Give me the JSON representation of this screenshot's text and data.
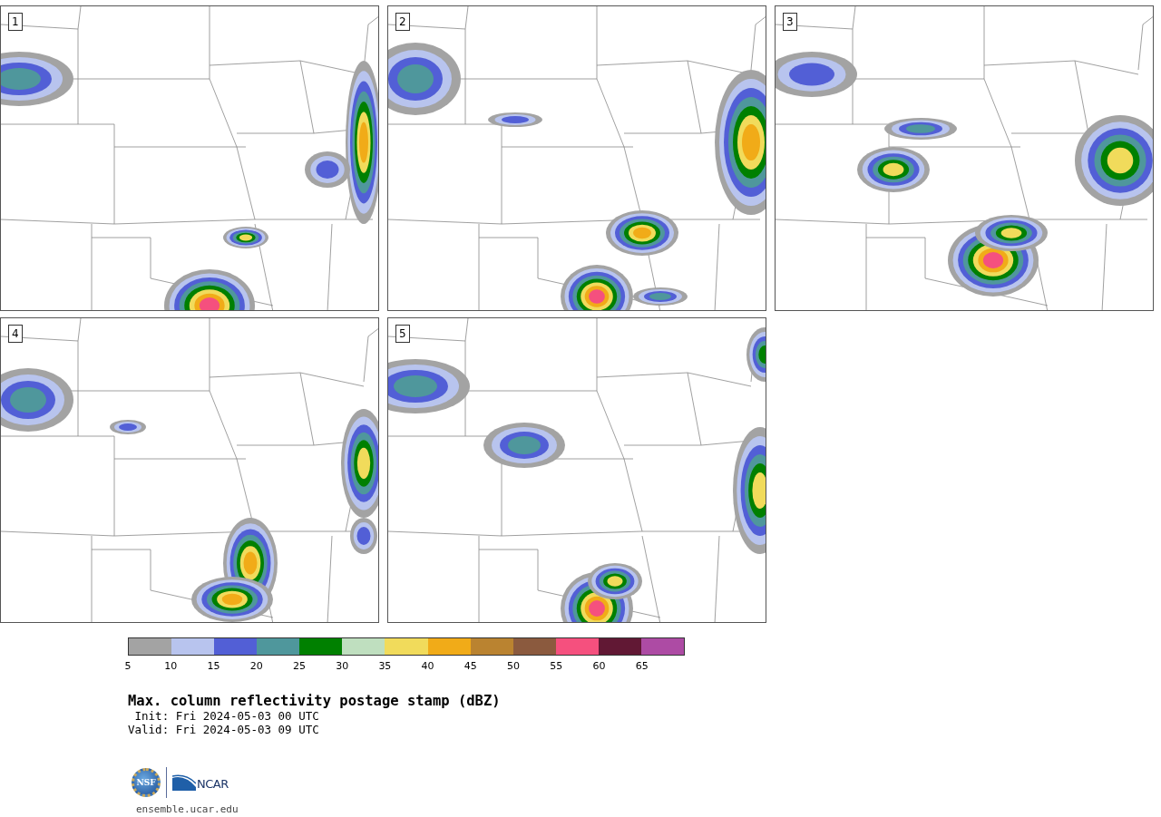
{
  "panels": [
    {
      "number": "1"
    },
    {
      "number": "2"
    },
    {
      "number": "3"
    },
    {
      "number": "4"
    },
    {
      "number": "5"
    }
  ],
  "colorbar": {
    "segments": [
      {
        "color": "#a3a3a3",
        "label": "5"
      },
      {
        "color": "#b8c4ee",
        "label": "10"
      },
      {
        "color": "#525fd6",
        "label": "15"
      },
      {
        "color": "#4f979c",
        "label": "20"
      },
      {
        "color": "#008000",
        "label": "25"
      },
      {
        "color": "#bfdfbf",
        "label": "30"
      },
      {
        "color": "#f1db5b",
        "label": "35"
      },
      {
        "color": "#f1ab18",
        "label": "40"
      },
      {
        "color": "#ba8330",
        "label": "45"
      },
      {
        "color": "#8b5a3e",
        "label": "50"
      },
      {
        "color": "#f5507e",
        "label": "55"
      },
      {
        "color": "#611834",
        "label": "60"
      },
      {
        "color": "#ad4ba4",
        "label": "65"
      }
    ]
  },
  "title": "Max. column reflectivity postage stamp (dBZ)",
  "init": " Init: Fri 2024-05-03 00 UTC",
  "valid": "Valid: Fri 2024-05-03 09 UTC",
  "logos": {
    "nsf": "NSF",
    "ncar": "NCAR"
  },
  "footer": "ensemble.ucar.edu"
}
